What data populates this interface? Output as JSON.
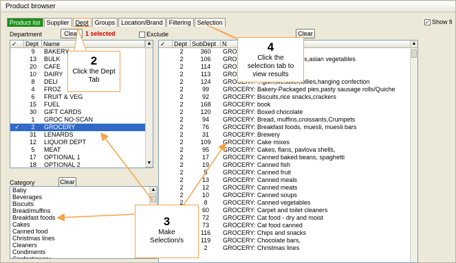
{
  "window": {
    "title": "Product browser"
  },
  "tabs": [
    {
      "label": "Product list"
    },
    {
      "label": "Supplier"
    },
    {
      "label": "Dept"
    },
    {
      "label": "Groups"
    },
    {
      "label": "Location/Brand"
    },
    {
      "label": "Filtering"
    },
    {
      "label": "Selection"
    }
  ],
  "show_filter": {
    "label": "Show fi"
  },
  "department": {
    "label": "Department",
    "clear_label": "Clear",
    "selected_text": "1 selected",
    "exclude_label": "Exclude",
    "columns": [
      "✓",
      "Dept",
      "Name"
    ],
    "rows": [
      {
        "check": "",
        "dept": "9",
        "name": "BAKERY"
      },
      {
        "check": "",
        "dept": "13",
        "name": "BULK"
      },
      {
        "check": "",
        "dept": "20",
        "name": "CAFE"
      },
      {
        "check": "",
        "dept": "10",
        "name": "DAIRY"
      },
      {
        "check": "",
        "dept": "8",
        "name": "DELI"
      },
      {
        "check": "",
        "dept": "4",
        "name": "FROZ"
      },
      {
        "check": "",
        "dept": "6",
        "name": "FRUIT & VEG"
      },
      {
        "check": "",
        "dept": "15",
        "name": "FUEL"
      },
      {
        "check": "",
        "dept": "30",
        "name": "GIFT CARDS"
      },
      {
        "check": "",
        "dept": "1",
        "name": "GROC NO-SCAN"
      },
      {
        "check": "✓",
        "dept": "2",
        "name": "GROCERY"
      },
      {
        "check": "",
        "dept": "31",
        "name": "LENARDS"
      },
      {
        "check": "",
        "dept": "12",
        "name": "LIQUOR DEPT"
      },
      {
        "check": "",
        "dept": "5",
        "name": "MEAT"
      },
      {
        "check": "",
        "dept": "17",
        "name": "OPTIONAL 1"
      },
      {
        "check": "",
        "dept": "18",
        "name": "OPTIONAL 2"
      }
    ]
  },
  "subdept": {
    "clear_label": "Clear",
    "columns": [
      "✓",
      "Dept",
      "SubDept",
      "N"
    ],
    "rows": [
      {
        "dept": "2",
        "sub": "360",
        "name": "GROCERY: "
      },
      {
        "dept": "2",
        "sub": "106",
        "name": "GROCERY: ...s, pastes,curries,asian vegetables"
      },
      {
        "dept": "2",
        "sub": "114",
        "name": "GROCERY: ...cereals"
      },
      {
        "dept": "2",
        "sub": "113",
        "name": "GROCERY: ...ottles, nappies"
      },
      {
        "dept": "2",
        "sub": "124",
        "name": "GROCERY: ...gum,lifesaver,lollies,hanging confection"
      },
      {
        "dept": "2",
        "sub": "99",
        "name": "GROCERY: Bakery-Packaged pies,pasty sausage rolls/Quiche"
      },
      {
        "dept": "2",
        "sub": "92",
        "name": "GROCERY: Biscuits,rice snacks,crackers"
      },
      {
        "dept": "2",
        "sub": "168",
        "name": "GROCERY: book"
      },
      {
        "dept": "2",
        "sub": "120",
        "name": "GROCERY: Boxed chocolate"
      },
      {
        "dept": "2",
        "sub": "94",
        "name": "GROCERY: Bread, muffins,croissants,Crumpets"
      },
      {
        "dept": "2",
        "sub": "76",
        "name": "GROCERY: Breakfast foods, muesli, muesli bars"
      },
      {
        "dept": "2",
        "sub": "31",
        "name": "GROCERY: Brewery"
      },
      {
        "dept": "2",
        "sub": "109",
        "name": "GROCERY: Cake mixes"
      },
      {
        "dept": "2",
        "sub": "95",
        "name": "GROCERY: Cakes, flans, pavlova shells,"
      },
      {
        "dept": "2",
        "sub": "17",
        "name": "GROCERY: Canned baked beans, spaghetti"
      },
      {
        "dept": "2",
        "sub": "19",
        "name": "GROCERY: Canned fish"
      },
      {
        "dept": "2",
        "sub": "5",
        "name": "GROCERY: Canned fruit"
      },
      {
        "dept": "2",
        "sub": "13",
        "name": "GROCERY: Canned meals"
      },
      {
        "dept": "2",
        "sub": "12",
        "name": "GROCERY: Canned meats"
      },
      {
        "dept": "2",
        "sub": "10",
        "name": "GROCERY: Canned soups"
      },
      {
        "dept": "2",
        "sub": "8",
        "name": "GROCERY: Canned vegetables"
      },
      {
        "dept": "2",
        "sub": "60",
        "name": "GROCERY: Carpet and toilet cleaners"
      },
      {
        "dept": "2",
        "sub": "72",
        "name": "GROCERY: Cat food - dry and moist"
      },
      {
        "dept": "2",
        "sub": "73",
        "name": "GROCERY: Cat food canned"
      },
      {
        "dept": "2",
        "sub": "116",
        "name": "GROCERY: Chips and snacks"
      },
      {
        "dept": "2",
        "sub": "119",
        "name": "GROCERY: Chocolate bars,"
      },
      {
        "dept": "2",
        "sub": "2",
        "name": "GROCERY: Christmas lines"
      }
    ]
  },
  "category": {
    "label": "Category",
    "clear_label": "Clear",
    "items": [
      "Baby",
      "Beverages",
      "Biscuits",
      "Bread/muffins",
      "Breakfast foods",
      "Cakes",
      "Canned food",
      "Christmas lines",
      "Cleaners",
      "Condiments",
      "Confectionery"
    ]
  },
  "callouts": [
    {
      "number": "2",
      "text": "Click the Dept Tab"
    },
    {
      "number": "3",
      "text": "Make Selection/s"
    },
    {
      "number": "4",
      "text": "Click the selection tab to view results"
    }
  ],
  "colors": {
    "accent": "#f5a24b",
    "selection": "#3169c6",
    "active_tab": "#1a8f1a",
    "selected_text": "#cc0000"
  }
}
